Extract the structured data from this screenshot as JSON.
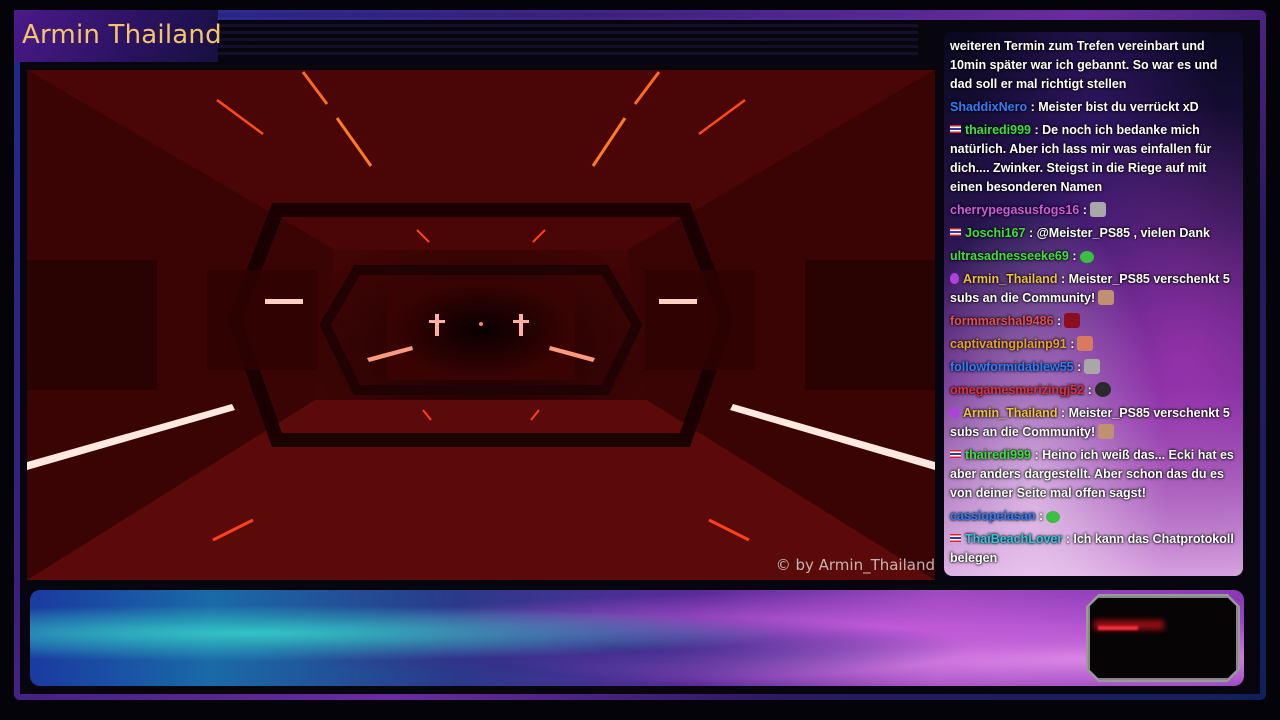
{
  "overlay": {
    "channel_title": "Armin Thailand",
    "watermark": "© by Armin_Thailand"
  },
  "chat": {
    "messages": [
      {
        "user": "",
        "user_color": "#ffffff",
        "badge": "none",
        "text": "weiteren Termin zum Trefen vereinbart und 10min später war ich gebannt. So war es und dad soll er mal richtigt stellen",
        "emote": ""
      },
      {
        "user": "ShaddixNero",
        "user_color": "#2e7dff",
        "badge": "none",
        "text": ": Meister bist du verrückt xD",
        "emote": ""
      },
      {
        "user": "thairedi999",
        "user_color": "#3ee03e",
        "badge": "flag",
        "text": ": De noch ich bedanke mich natürlich. Aber ich lass mir was einfallen für dich.... Zwinker. Steigst in die Riege auf mit einen besonderen Namen",
        "emote": ""
      },
      {
        "user": "cherrypegasusfogs16",
        "user_color": "#d25ae0",
        "badge": "none",
        "text": ":",
        "emote": "grey"
      },
      {
        "user": "Joschi167",
        "user_color": "#3ee03e",
        "badge": "flag",
        "text": ": @Meister_PS85 , vielen Dank",
        "emote": ""
      },
      {
        "user": "ultrasadnesseeke69",
        "user_color": "#3ee03e",
        "badge": "none",
        "text": ":",
        "emote": "green"
      },
      {
        "user": "Armin_Thailand",
        "user_color": "#f0c040",
        "badge": "sub",
        "text": ": Meister_PS85 verschenkt 5 subs an die Community!",
        "emote": "face"
      },
      {
        "user": "formmarshal9486",
        "user_color": "#e05050",
        "badge": "none",
        "text": ":",
        "emote": "red"
      },
      {
        "user": "captivatingplainp91",
        "user_color": "#e8a030",
        "badge": "none",
        "text": ":",
        "emote": "hand"
      },
      {
        "user": "followformidablew55",
        "user_color": "#2e7dff",
        "badge": "none",
        "text": ":",
        "emote": "grey"
      },
      {
        "user": "omegamesmerizingj52",
        "user_color": "#e03040",
        "badge": "none",
        "text": ":",
        "emote": "dark"
      },
      {
        "user": "Armin_Thailand",
        "user_color": "#f0c040",
        "badge": "sub",
        "text": ": Meister_PS85 verschenkt 5 subs an die Community!",
        "emote": "face"
      },
      {
        "user": "thairedi999",
        "user_color": "#3ee03e",
        "badge": "flag",
        "text": ": Heino ich weiß das... Ecki hat es aber anders dargestellt. Aber schon das du es von deiner Seite mal offen sagst!",
        "emote": ""
      },
      {
        "user": "cassiopeiasan",
        "user_color": "#2e7dff",
        "badge": "none",
        "text": ":",
        "emote": "green"
      },
      {
        "user": "ThaiBeachLover",
        "user_color": "#2ec8e0",
        "badge": "flag",
        "text": ": Ich kann das Chatprotokoll belegen",
        "emote": ""
      }
    ]
  }
}
